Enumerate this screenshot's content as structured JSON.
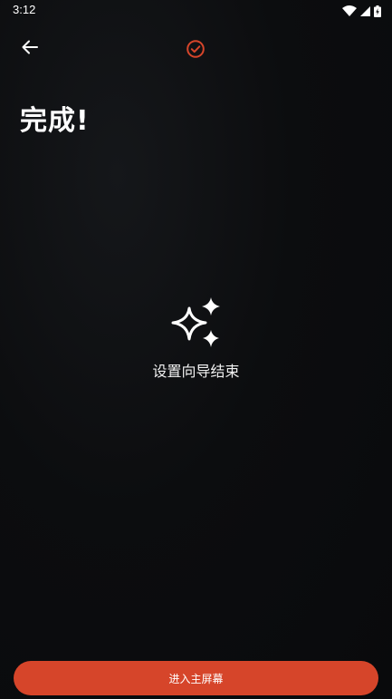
{
  "status_bar": {
    "time": "3:12",
    "icons": [
      "wifi-icon",
      "signal-icon",
      "battery-charging-icon"
    ]
  },
  "top_bar": {
    "back_icon": "arrow-left-icon",
    "step_icon": "check-circle-icon"
  },
  "page": {
    "title": "完成!",
    "center_icon": "sparkles-icon",
    "message": "设置向导结束"
  },
  "footer": {
    "primary_button_label": "进入主屏幕"
  },
  "colors": {
    "accent": "#d6452a",
    "background": "#0b0c0e",
    "text": "#ffffff"
  }
}
